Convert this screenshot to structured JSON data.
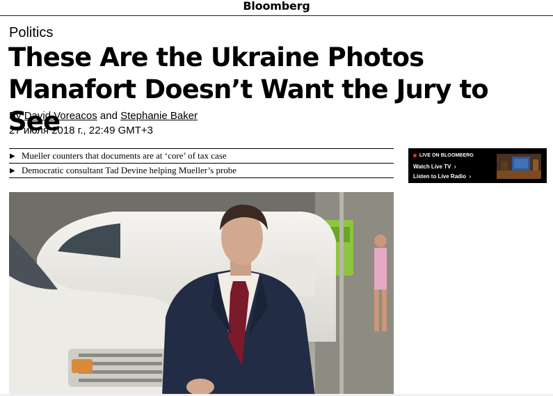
{
  "header": {
    "brand": "Bloomberg"
  },
  "article": {
    "section": "Politics",
    "headline": "These Are the Ukraine Photos Manafort Doesn’t Want the Jury to See",
    "byline_prefix": "By",
    "author1": "David Voreacos",
    "byline_and": "and",
    "author2": "Stephanie Baker",
    "date": "27 июля 2018 г., 22:49 GMT+3"
  },
  "related": [
    {
      "text": "Mueller counters that documents are at ‘core’ of tax case"
    },
    {
      "text": "Democratic consultant Tad Devine helping Mueller’s probe"
    }
  ],
  "live": {
    "label": "LIVE ON BLOOMBERG",
    "tv_link": "Watch Live TV",
    "radio_link": "Listen to Live Radio"
  },
  "icons": {
    "live_dot_color": "#e8302d",
    "related_arrow": "triangle-right-icon",
    "link_chevron": "chevron-right-icon"
  }
}
